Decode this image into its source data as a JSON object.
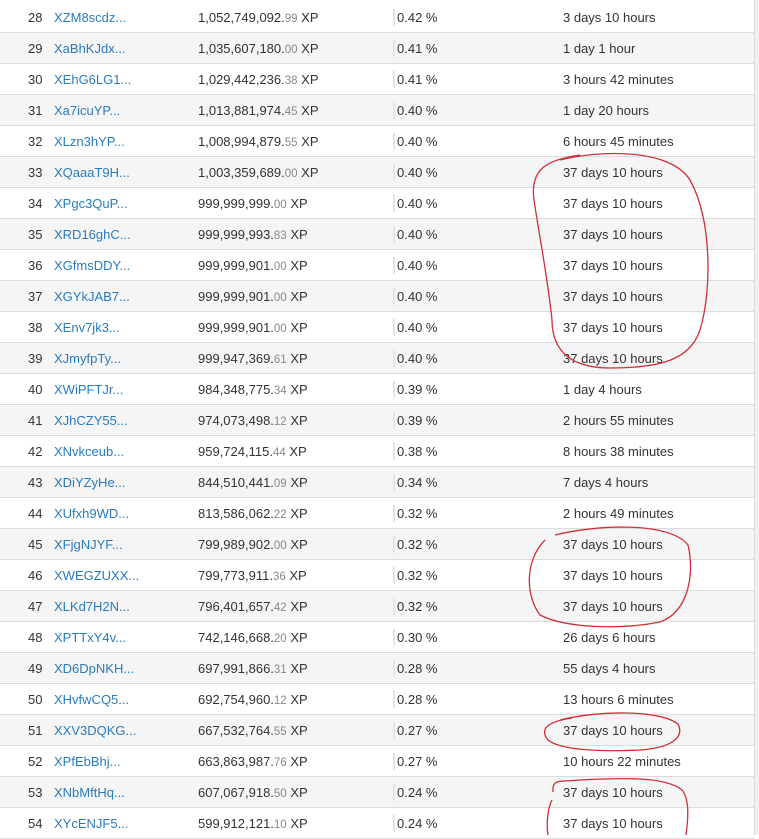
{
  "rows": [
    {
      "rank": "28",
      "address": "XZM8scdz...",
      "balance_int": "1,052,749,092.",
      "balance_dec": "99",
      "unit": "XP",
      "percent": "0.42 %",
      "last_active": "3 days 10 hours"
    },
    {
      "rank": "29",
      "address": "XaBhKJdx...",
      "balance_int": "1,035,607,180.",
      "balance_dec": "00",
      "unit": "XP",
      "percent": "0.41 %",
      "last_active": "1 day 1 hour"
    },
    {
      "rank": "30",
      "address": "XEhG6LG1...",
      "balance_int": "1,029,442,236.",
      "balance_dec": "38",
      "unit": "XP",
      "percent": "0.41 %",
      "last_active": "3 hours 42 minutes"
    },
    {
      "rank": "31",
      "address": "Xa7icuYP...",
      "balance_int": "1,013,881,974.",
      "balance_dec": "45",
      "unit": "XP",
      "percent": "0.40 %",
      "last_active": "1 day 20 hours"
    },
    {
      "rank": "32",
      "address": "XLzn3hYP...",
      "balance_int": "1,008,994,879.",
      "balance_dec": "55",
      "unit": "XP",
      "percent": "0.40 %",
      "last_active": "6 hours 45 minutes"
    },
    {
      "rank": "33",
      "address": "XQaaaT9H...",
      "balance_int": "1,003,359,689.",
      "balance_dec": "00",
      "unit": "XP",
      "percent": "0.40 %",
      "last_active": "37 days 10 hours"
    },
    {
      "rank": "34",
      "address": "XPgc3QuP...",
      "balance_int": "999,999,999.",
      "balance_dec": "00",
      "unit": "XP",
      "percent": "0.40 %",
      "last_active": "37 days 10 hours"
    },
    {
      "rank": "35",
      "address": "XRD16ghC...",
      "balance_int": "999,999,993.",
      "balance_dec": "83",
      "unit": "XP",
      "percent": "0.40 %",
      "last_active": "37 days 10 hours"
    },
    {
      "rank": "36",
      "address": "XGfmsDDY...",
      "balance_int": "999,999,901.",
      "balance_dec": "00",
      "unit": "XP",
      "percent": "0.40 %",
      "last_active": "37 days 10 hours"
    },
    {
      "rank": "37",
      "address": "XGYkJAB7...",
      "balance_int": "999,999,901.",
      "balance_dec": "00",
      "unit": "XP",
      "percent": "0.40 %",
      "last_active": "37 days 10 hours"
    },
    {
      "rank": "38",
      "address": "XEnv7jk3...",
      "balance_int": "999,999,901.",
      "balance_dec": "00",
      "unit": "XP",
      "percent": "0.40 %",
      "last_active": "37 days 10 hours"
    },
    {
      "rank": "39",
      "address": "XJmyfpTy...",
      "balance_int": "999,947,369.",
      "balance_dec": "61",
      "unit": "XP",
      "percent": "0.40 %",
      "last_active": "37 days 10 hours"
    },
    {
      "rank": "40",
      "address": "XWiPFTJr...",
      "balance_int": "984,348,775.",
      "balance_dec": "34",
      "unit": "XP",
      "percent": "0.39 %",
      "last_active": "1 day 4 hours"
    },
    {
      "rank": "41",
      "address": "XJhCZY55...",
      "balance_int": "974,073,498.",
      "balance_dec": "12",
      "unit": "XP",
      "percent": "0.39 %",
      "last_active": "2 hours 55 minutes"
    },
    {
      "rank": "42",
      "address": "XNvkceub...",
      "balance_int": "959,724,115.",
      "balance_dec": "44",
      "unit": "XP",
      "percent": "0.38 %",
      "last_active": "8 hours 38 minutes"
    },
    {
      "rank": "43",
      "address": "XDiYZyHe...",
      "balance_int": "844,510,441.",
      "balance_dec": "09",
      "unit": "XP",
      "percent": "0.34 %",
      "last_active": "7 days 4 hours"
    },
    {
      "rank": "44",
      "address": "XUfxh9WD...",
      "balance_int": "813,586,062.",
      "balance_dec": "22",
      "unit": "XP",
      "percent": "0.32 %",
      "last_active": "2 hours 49 minutes"
    },
    {
      "rank": "45",
      "address": "XFjgNJYF...",
      "balance_int": "799,989,902.",
      "balance_dec": "00",
      "unit": "XP",
      "percent": "0.32 %",
      "last_active": "37 days 10 hours"
    },
    {
      "rank": "46",
      "address": "XWEGZUXX...",
      "balance_int": "799,773,911.",
      "balance_dec": "36",
      "unit": "XP",
      "percent": "0.32 %",
      "last_active": "37 days 10 hours"
    },
    {
      "rank": "47",
      "address": "XLKd7H2N...",
      "balance_int": "796,401,657.",
      "balance_dec": "42",
      "unit": "XP",
      "percent": "0.32 %",
      "last_active": "37 days 10 hours"
    },
    {
      "rank": "48",
      "address": "XPTTxY4v...",
      "balance_int": "742,146,668.",
      "balance_dec": "20",
      "unit": "XP",
      "percent": "0.30 %",
      "last_active": "26 days 6 hours"
    },
    {
      "rank": "49",
      "address": "XD6DpNKH...",
      "balance_int": "697,991,866.",
      "balance_dec": "31",
      "unit": "XP",
      "percent": "0.28 %",
      "last_active": "55 days 4 hours"
    },
    {
      "rank": "50",
      "address": "XHvfwCQ5...",
      "balance_int": "692,754,960.",
      "balance_dec": "12",
      "unit": "XP",
      "percent": "0.28 %",
      "last_active": "13 hours 6 minutes"
    },
    {
      "rank": "51",
      "address": "XXV3DQKG...",
      "balance_int": "667,532,764.",
      "balance_dec": "55",
      "unit": "XP",
      "percent": "0.27 %",
      "last_active": "37 days 10 hours"
    },
    {
      "rank": "52",
      "address": "XPfEbBhj...",
      "balance_int": "663,863,987.",
      "balance_dec": "76",
      "unit": "XP",
      "percent": "0.27 %",
      "last_active": "10 hours 22 minutes"
    },
    {
      "rank": "53",
      "address": "XNbMftHq...",
      "balance_int": "607,067,918.",
      "balance_dec": "50",
      "unit": "XP",
      "percent": "0.24 %",
      "last_active": "37 days 10 hours"
    },
    {
      "rank": "54",
      "address": "XYcENJF5...",
      "balance_int": "599,912,121.",
      "balance_dec": "10",
      "unit": "XP",
      "percent": "0.24 %",
      "last_active": "37 days 10 hours"
    }
  ],
  "annotation_color": "#d0303a"
}
